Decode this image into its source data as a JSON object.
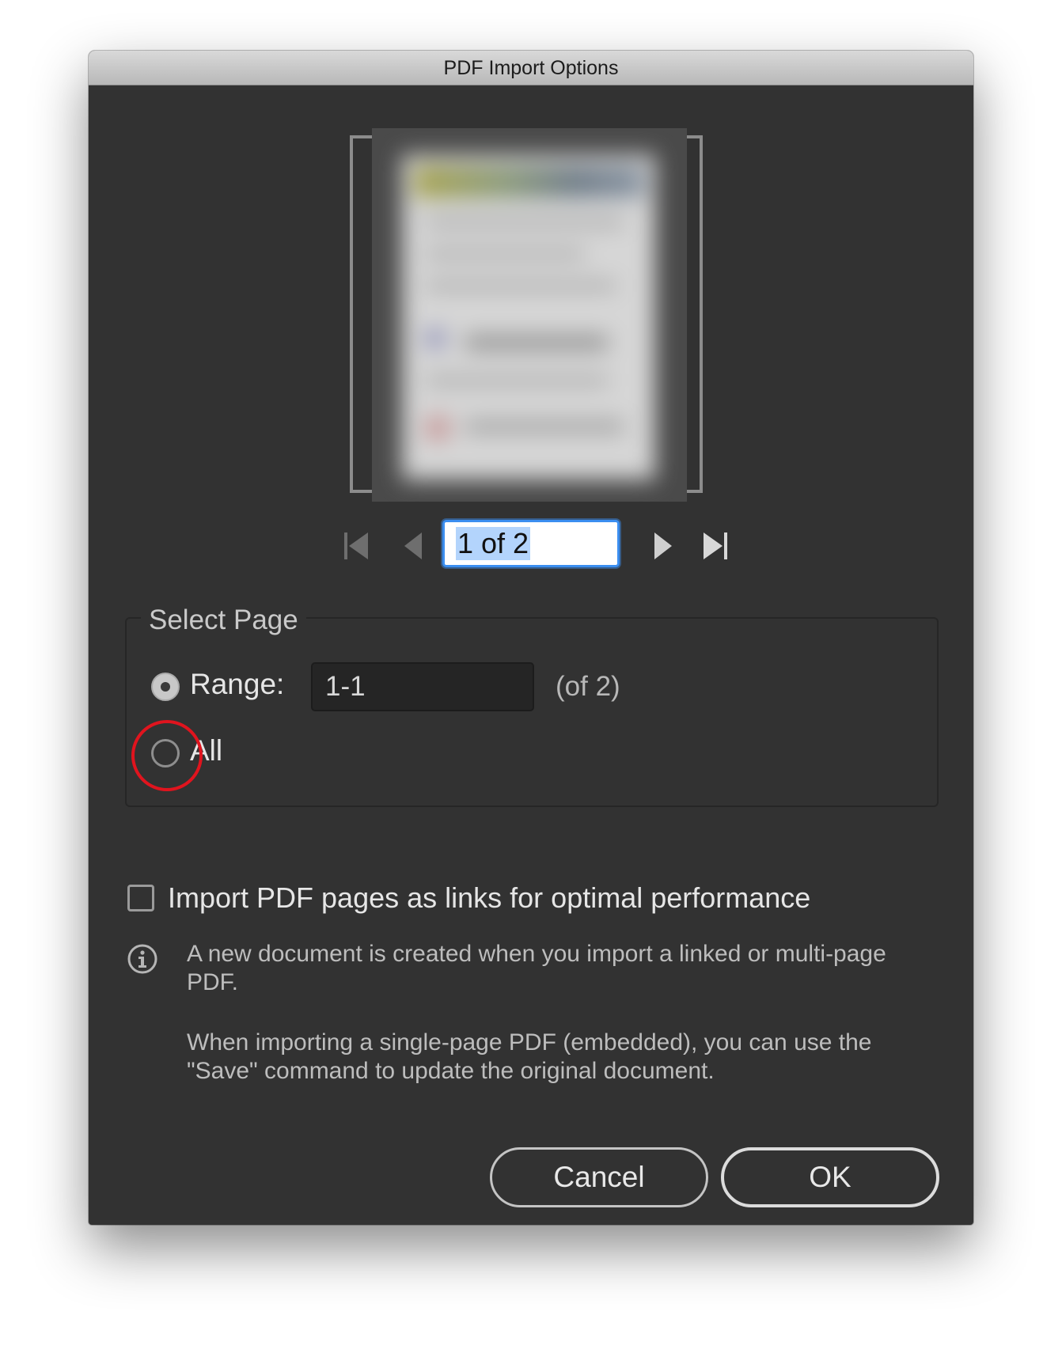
{
  "window": {
    "title": "PDF Import Options"
  },
  "navigation": {
    "page_value": "1 of 2",
    "first_icon": "skip-to-first-icon",
    "prev_icon": "previous-page-icon",
    "next_icon": "next-page-icon",
    "last_icon": "skip-to-last-icon"
  },
  "select_page": {
    "title": "Select Page",
    "range_label": "Range:",
    "range_value": "1-1",
    "range_total": "(of 2)",
    "all_label": "All",
    "selected_option": "Range"
  },
  "links_option": {
    "label": "Import PDF pages as links for optimal performance",
    "checked": false
  },
  "info": {
    "icon": "info-icon",
    "paragraph1": "A new document is created when you import a linked or multi-page PDF.",
    "paragraph2": "When importing a single-page PDF (embedded), you can use the \"Save\" command to update the original document."
  },
  "buttons": {
    "cancel": "Cancel",
    "ok": "OK"
  },
  "colors": {
    "dialog_bg": "#323232",
    "focus_ring": "#3b8ef0",
    "annotation_circle": "#e0141e"
  }
}
